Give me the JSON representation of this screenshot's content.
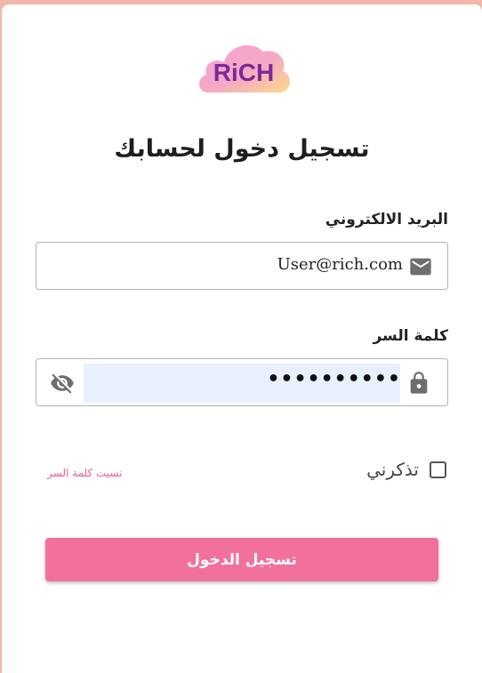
{
  "logo": {
    "text": "RiCH"
  },
  "title": "تسجيل دخول لحسابك",
  "email": {
    "label": "البريد الالكتروني",
    "value": "User@rich.com",
    "icon": "mail-icon"
  },
  "password": {
    "label": "كلمة السر",
    "masked_value": "••••••••••",
    "lock_icon": "lock-icon",
    "toggle_icon": "eye-off-icon"
  },
  "remember": {
    "label": "تذكرني",
    "checked": false
  },
  "forgot_password": "نسيت كلمة السر",
  "login_button": "تسجيل الدخول",
  "colors": {
    "background": "#f3b6a8",
    "accent": "#f2709c",
    "link": "#e8608a",
    "autofill": "#e8f0fe"
  }
}
